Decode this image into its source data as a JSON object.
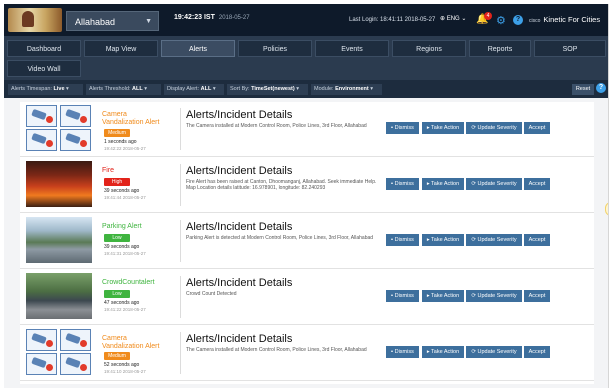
{
  "header": {
    "city_select": "Allahabad",
    "time": "19:42:23 IST",
    "date": "2018-05-27",
    "last_login": "Last Login: 18:41:11 2018-05-27",
    "language": "ENG",
    "notification_count": "4",
    "brand_small": "cisco",
    "brand": "Kinetic For Cities"
  },
  "nav": {
    "tabs": [
      "Dashboard",
      "Map View",
      "Alerts",
      "Policies",
      "Events",
      "Regions",
      "Reports",
      "SOP",
      "Video Wall"
    ],
    "active_tab": "Alerts"
  },
  "filters": {
    "timespan_label": "Alerts Timespan:",
    "timespan_value": "Live",
    "threshold_label": "Alerts Threshold:",
    "threshold_value": "ALL",
    "display_label": "Display Alert:",
    "display_value": "ALL",
    "sort_label": "Sort By:",
    "sort_value": "TimeSet(newest)",
    "module_label": "Module:",
    "module_value": "Environment",
    "reset_label": "Reset"
  },
  "actions": {
    "dismiss": "Dismiss",
    "take_action": "Take Action",
    "update_severity": "Update Severity",
    "accept": "Accept"
  },
  "alerts": [
    {
      "title": "Camera Vandalization Alert",
      "severity": "Medium",
      "ago": "1 seconds ago",
      "timestamp": "19:42:22 2018-05-27",
      "heading": "Alerts/Incident Details",
      "detail": "The Camera installed at Modern Control Room, Police Lines, 3rd Floor, Allahabad"
    },
    {
      "title": "Fire",
      "severity": "High",
      "ago": "39 seconds ago",
      "timestamp": "19:41:44 2018-05-27",
      "heading": "Alerts/Incident Details",
      "detail": "Fire Alert has been raised at Canton, Dhoomanganj, Allahabad. Seek immediate Help. Map Location details latitude: 16.978901, longitude: 82.240293"
    },
    {
      "title": "Parking Alert",
      "severity": "Low",
      "ago": "39 seconds ago",
      "timestamp": "19:41:31 2018-05-27",
      "heading": "Alerts/Incident Details",
      "detail": "Parking Alert is detected at Modern Control Room, Police Lines, 3rd Floor, Allahabad"
    },
    {
      "title": "CrowdCountalert",
      "severity": "Low",
      "ago": "47 seconds ago",
      "timestamp": "19:41:22 2018-05-27",
      "heading": "Alerts/Incident Details",
      "detail": "Crowd Count Detected"
    },
    {
      "title": "Camera Vandalization Alert",
      "severity": "Medium",
      "ago": "52 seconds ago",
      "timestamp": "19:41:10 2018-05-27",
      "heading": "Alerts/Incident Details",
      "detail": "The Camera installed at Modern Control Room, Police Lines, 3rd Floor, Allahabad"
    }
  ]
}
